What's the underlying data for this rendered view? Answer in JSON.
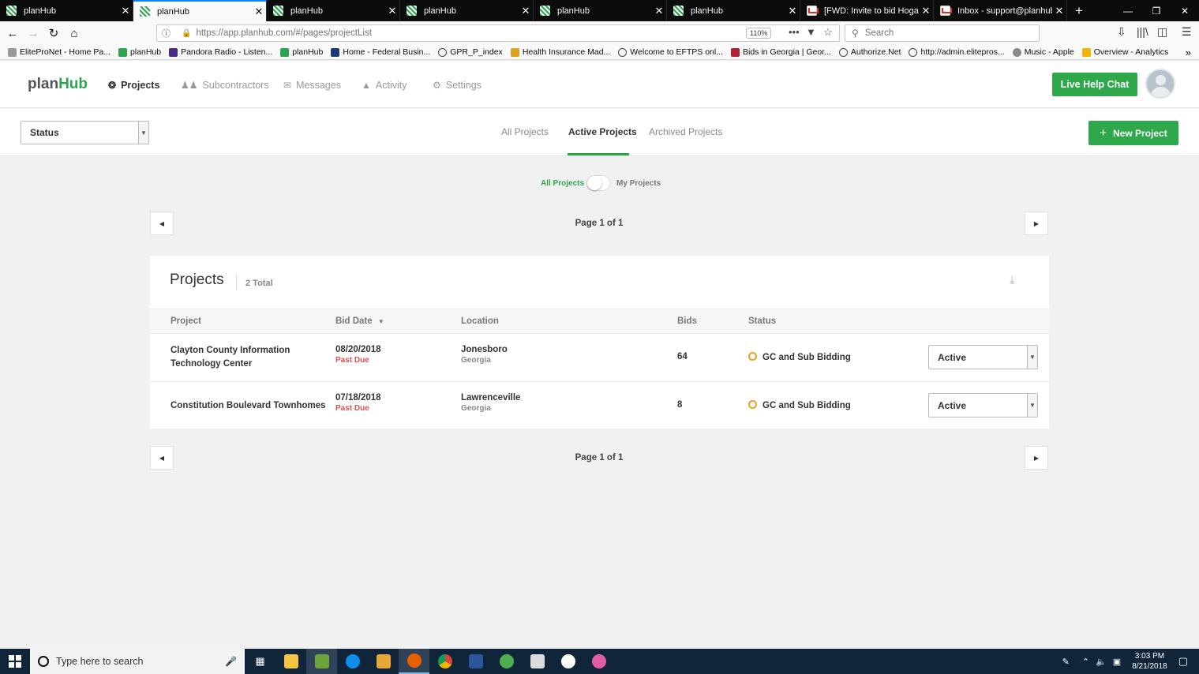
{
  "browser": {
    "tabs": [
      {
        "title": "planHub",
        "icon": "planhub-favicon",
        "active": false
      },
      {
        "title": "planHub",
        "icon": "planhub-favicon",
        "active": true
      },
      {
        "title": "planHub",
        "icon": "planhub-favicon",
        "active": false
      },
      {
        "title": "planHub",
        "icon": "planhub-favicon",
        "active": false
      },
      {
        "title": "planHub",
        "icon": "planhub-favicon",
        "active": false
      },
      {
        "title": "planHub",
        "icon": "planhub-favicon",
        "active": false
      },
      {
        "title": "[FWD: Invite to bid Hogansv",
        "icon": "gmail-favicon",
        "active": false
      },
      {
        "title": "Inbox - support@planhub.co",
        "icon": "gmail-favicon",
        "active": false
      }
    ],
    "url": "https://app.planhub.com/#/pages/projectList",
    "zoom": "110%",
    "search_placeholder": "Search",
    "bookmarks": [
      "EliteProNet - Home Pa...",
      "planHub",
      "Pandora Radio - Listen...",
      "planHub",
      "Home - Federal Busin...",
      "GPR_P_index",
      "Health Insurance Mad...",
      "Welcome to EFTPS onl...",
      "Bids in Georgia | Geor...",
      "Authorize.Net",
      "http://admin.elitepros...",
      "Music - Apple",
      "Overview - Analytics"
    ]
  },
  "app": {
    "logo_plan": "plan",
    "logo_hub": "Hub",
    "nav": {
      "projects": "Projects",
      "subcontractors": "Subcontractors",
      "messages": "Messages",
      "activity": "Activity",
      "settings": "Settings"
    },
    "live_help": "Live Help Chat",
    "status_select": "Status",
    "subtabs": {
      "all": "All Projects",
      "active": "Active Projects",
      "archived": "Archived Projects"
    },
    "new_project": "New Project",
    "toggle": {
      "left": "All Projects",
      "right": "My Projects"
    },
    "pager_text": "Page 1 of 1",
    "card": {
      "title": "Projects",
      "total": "2 Total",
      "columns": {
        "project": "Project",
        "bid_date": "Bid Date",
        "location": "Location",
        "bids": "Bids",
        "status": "Status"
      },
      "rows": [
        {
          "project": "Clayton County Information Technology Center",
          "bid_date": "08/20/2018",
          "due": "Past Due",
          "city": "Jonesboro",
          "state": "Georgia",
          "bids": "64",
          "status": "GC and Sub Bidding",
          "state_select": "Active"
        },
        {
          "project": "Constitution Boulevard Townhomes",
          "bid_date": "07/18/2018",
          "due": "Past Due",
          "city": "Lawrenceville",
          "state": "Georgia",
          "bids": "8",
          "status": "GC and Sub Bidding",
          "state_select": "Active"
        }
      ]
    }
  },
  "taskbar": {
    "search_placeholder": "Type here to search",
    "time": "3:03 PM",
    "date": "8/21/2018"
  },
  "colors": {
    "brand_green": "#2ea84a",
    "past_due_red": "#d9534f",
    "status_orange": "#f0a020"
  }
}
